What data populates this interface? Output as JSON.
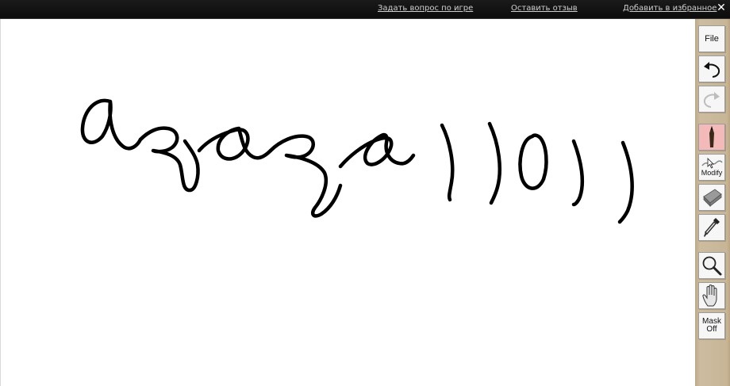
{
  "topbar": {
    "links": [
      {
        "label": "Задать вопрос по игре"
      },
      {
        "label": "Оставить отзыв"
      },
      {
        "label": "Добавить в избранное"
      }
    ],
    "close_glyph": "✕"
  },
  "toolbar": {
    "file_label": "File",
    "modify_label": "Modify",
    "mask_label_line1": "Mask",
    "mask_label_line2": "Off",
    "active_tool": "pencil",
    "active_color": "#f4b9b9",
    "icons": [
      "undo-icon",
      "redo-icon",
      "pencil-icon",
      "modify-icon",
      "eraser-icon",
      "eyedropper-icon",
      "magnifier-icon",
      "hand-icon"
    ]
  },
  "canvas": {
    "stroke_color": "#000000",
    "handwriting_text": "азаза))0))"
  }
}
